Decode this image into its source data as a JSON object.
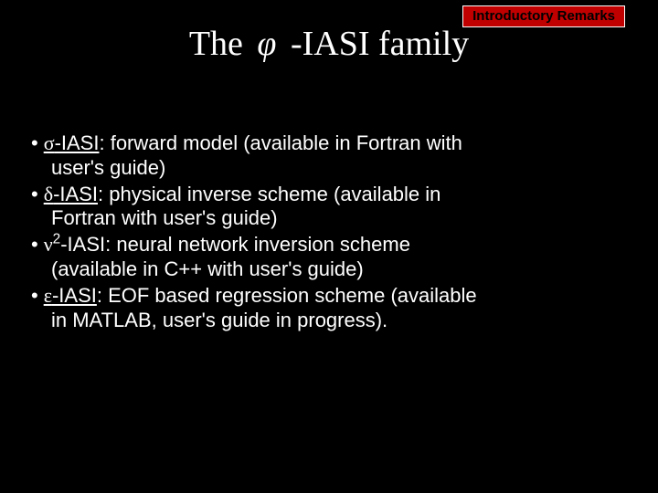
{
  "header": {
    "tag": "Introductory Remarks"
  },
  "title": {
    "prefix": "The",
    "symbol": "φ",
    "suffix": "-IASI family"
  },
  "bullets": [
    {
      "greek": "σ",
      "label_dash": "-IASI",
      "colon": ":",
      "rest1": " forward model (available in Fortran with",
      "rest2": "user's guide)"
    },
    {
      "greek": "δ",
      "label_dash": "-IASI",
      "colon": ":",
      "rest1": " physical inverse scheme (available in",
      "rest2": "Fortran with user's guide)"
    },
    {
      "greek": "ν",
      "sup": "2",
      "label_dash": "-IASI",
      "colon": ":",
      "rest1": "   neural network inversion scheme",
      "rest2": "(available in C++ with user's guide)"
    },
    {
      "greek": "ε",
      "label_dash": "-IASI",
      "colon": ":",
      "rest1": " EOF based regression scheme (available",
      "rest2": "in MATLAB, user's guide in progress)."
    }
  ]
}
